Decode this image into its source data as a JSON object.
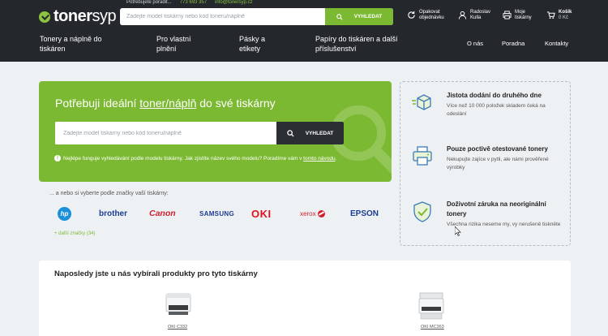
{
  "brand": {
    "name_bold": "toner",
    "name_light": "syp"
  },
  "topstrip": [
    "Potřebujete poradit...",
    "773 693 357",
    "info@tonersyp.cz"
  ],
  "search": {
    "placeholder": "Zadejte model tiskárny nebo kód toneru/náplně",
    "button_label": "VYHLEDAT"
  },
  "header_actions": {
    "reorder": {
      "line1": "Opakovat",
      "line2": "objednávku"
    },
    "account": {
      "line1": "Radoslav",
      "line2": "Kulla"
    },
    "printers": {
      "line1": "Moje",
      "line2": "tiskárny"
    },
    "cart": {
      "line1": "Košík",
      "line2": "0 Kč"
    }
  },
  "nav": {
    "items": [
      {
        "line1": "Tonery a náplně do",
        "line2": "tiskáren"
      },
      {
        "line1": "Pro vlastní",
        "line2": "plnění"
      },
      {
        "line1": "Pásky a",
        "line2": "etikety"
      },
      {
        "line1": "Papíry do tiskáren a další",
        "line2": "příslušenství"
      }
    ],
    "right": [
      "O nás",
      "Poradna",
      "Kontakty"
    ]
  },
  "hero": {
    "title_prefix": "Potřebuji ideální ",
    "title_link": "toner/náplň",
    "title_suffix": " do své tiskárny",
    "search_placeholder": "Zadejte model tiskárny nebo kód toneru/náplně",
    "search_button": "VYHLEDAT",
    "note_text": "Nejlépe funguje vyhledávání podle modelu tiskárny. Jak zjistíte název svého modelu? Poradíme vám v",
    "note_link": "tomto návodu",
    "note_end": "."
  },
  "brands": {
    "label": "... a nebo si vyberte podle značky vaší tiskárny:",
    "items": [
      "hp",
      "brother",
      "Canon",
      "SAMSUNG",
      "OKI",
      "xerox",
      "EPSON"
    ],
    "more": "+ další značky (34)"
  },
  "benefits": [
    {
      "icon": "delivery-box-icon",
      "title": "Jistota dodání do druhého dne",
      "desc": "Více než 10 000 položek skladem čeká na odeslání"
    },
    {
      "icon": "printer-icon",
      "title": "Pouze poctivě otestované tonery",
      "desc": "Nekupujte zajíce v pytli, ale námi prověřené výrobky"
    },
    {
      "icon": "shield-check-icon",
      "title": "Doživotní záruka na neoriginální tonery",
      "desc": "Všechna rizika neseme my, vy nerušeně tiskněte"
    }
  ],
  "recent": {
    "title": "Naposledy jste u nás vybírali produkty pro tyto tiskárny",
    "printers": [
      {
        "label": "OKI C332"
      },
      {
        "label": "OKI MC363"
      }
    ]
  },
  "colors": {
    "accent": "#7cb932",
    "header": "#24282d",
    "dark_button": "#2b2f34"
  }
}
